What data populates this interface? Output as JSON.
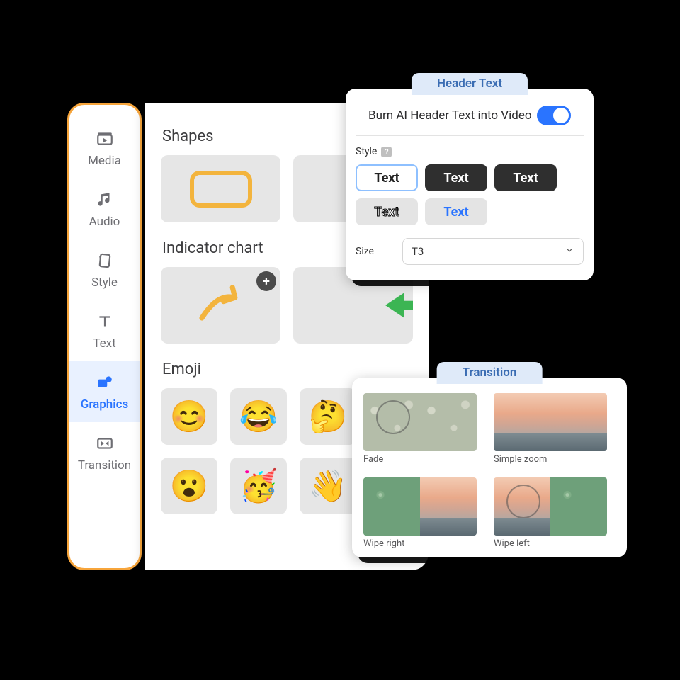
{
  "sidebar": {
    "items": [
      {
        "label": "Media"
      },
      {
        "label": "Audio"
      },
      {
        "label": "Style"
      },
      {
        "label": "Text"
      },
      {
        "label": "Graphics"
      },
      {
        "label": "Transition"
      }
    ],
    "active_index": 4
  },
  "graphics": {
    "section_shapes": "Shapes",
    "section_indicator": "Indicator chart",
    "section_emoji": "Emoji",
    "emojis": [
      "😊",
      "😂",
      "🤔",
      "😮",
      "🥳",
      "👋"
    ]
  },
  "header_panel": {
    "title": "Header Text",
    "burn_label": "Burn AI Header Text into Video",
    "burn_on": true,
    "style_label": "Style",
    "style_buttons": [
      "Text",
      "Text",
      "Text",
      "Text",
      "Text"
    ],
    "size_label": "Size",
    "size_value": "T3"
  },
  "transition_panel": {
    "title": "Transition",
    "items": [
      {
        "caption": "Fade"
      },
      {
        "caption": "Simple zoom"
      },
      {
        "caption": "Wipe right"
      },
      {
        "caption": "Wipe left"
      }
    ]
  }
}
